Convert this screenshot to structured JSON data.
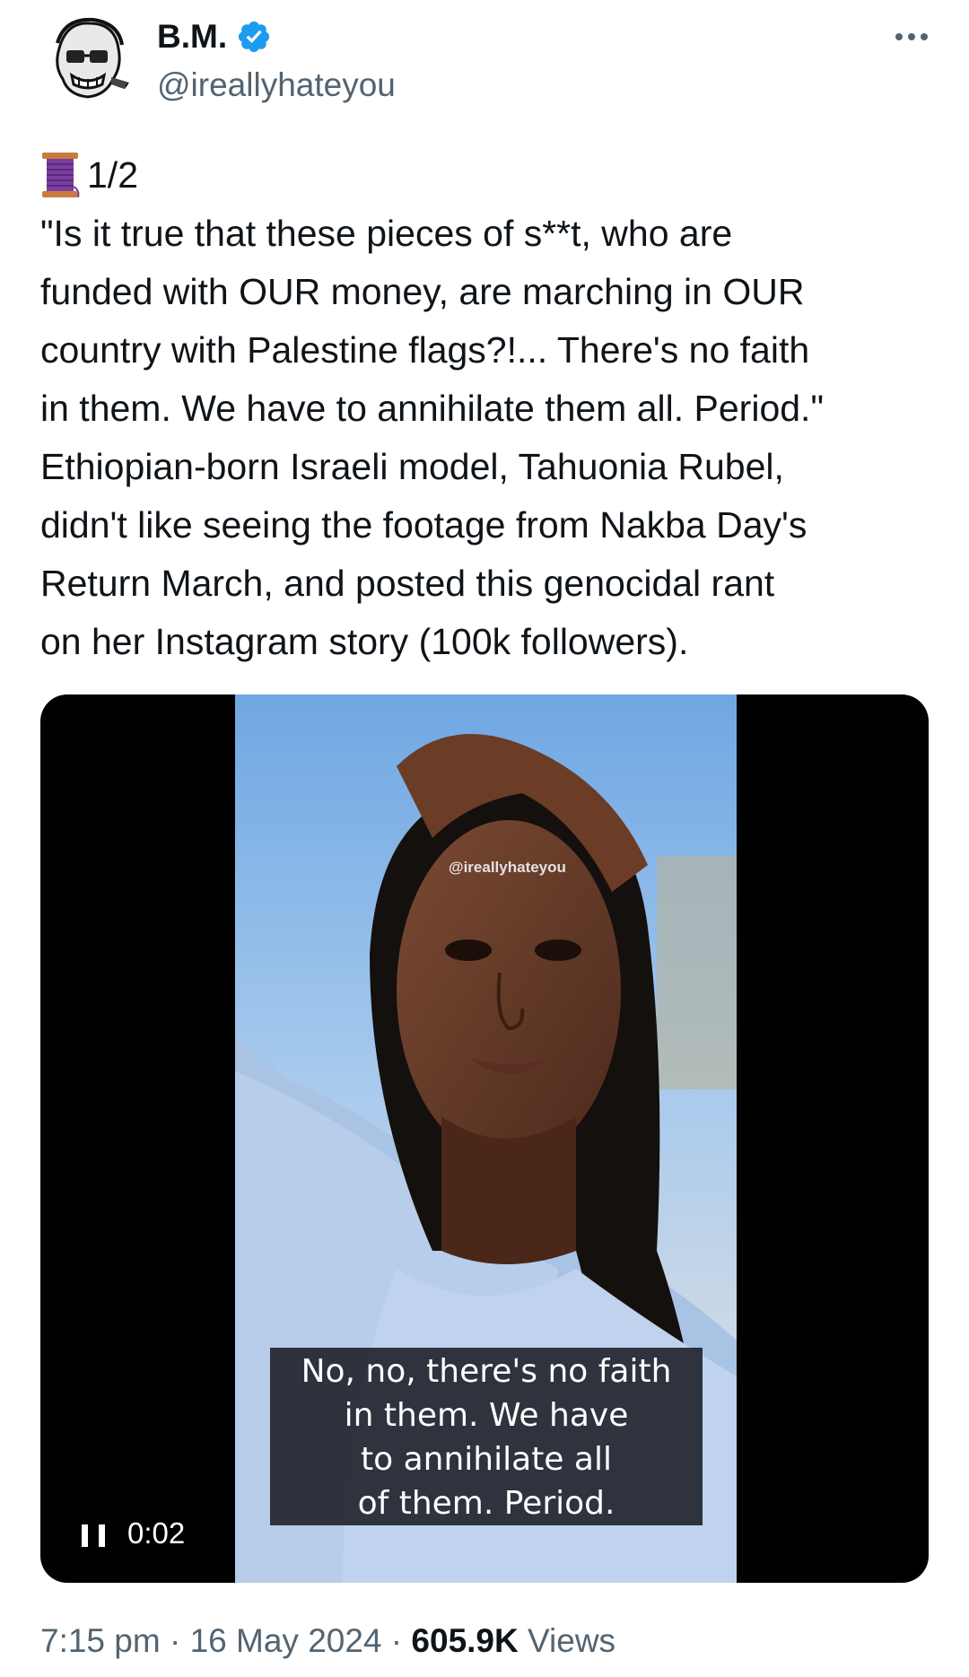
{
  "author": {
    "name": "B.M.",
    "handle": "@ireallyhateyou",
    "verified_color": "#1d9bf0"
  },
  "tweet": {
    "thread_icon": "spool-of-thread-emoji",
    "thread_counter": "1/2",
    "text": "\"Is it true that these pieces of s**t, who are\nfunded with OUR money, are marching in OUR\ncountry with Palestine flags?!... There's no faith\nin them. We have to annihilate them all. Period.\"\nEthiopian-born Israeli model, Tahuonia Rubel,\ndidn't like seeing the footage from Nakba Day's\nReturn March, and posted this genocidal rant\non her Instagram story (100k followers)."
  },
  "video": {
    "watermark": "@ireallyhateyou",
    "caption": "No, no, there's no faith\nin them. We have\nto annihilate all\nof them. Period.",
    "elapsed": "0:02",
    "control_icon": "pause-icon"
  },
  "meta": {
    "time": "7:15 pm",
    "separator": " · ",
    "date": "16 May 2024",
    "views_count": "605.9K",
    "views_label": " Views"
  },
  "colors": {
    "text": "#0f1419",
    "secondary": "#536471",
    "accent": "#1d9bf0"
  }
}
